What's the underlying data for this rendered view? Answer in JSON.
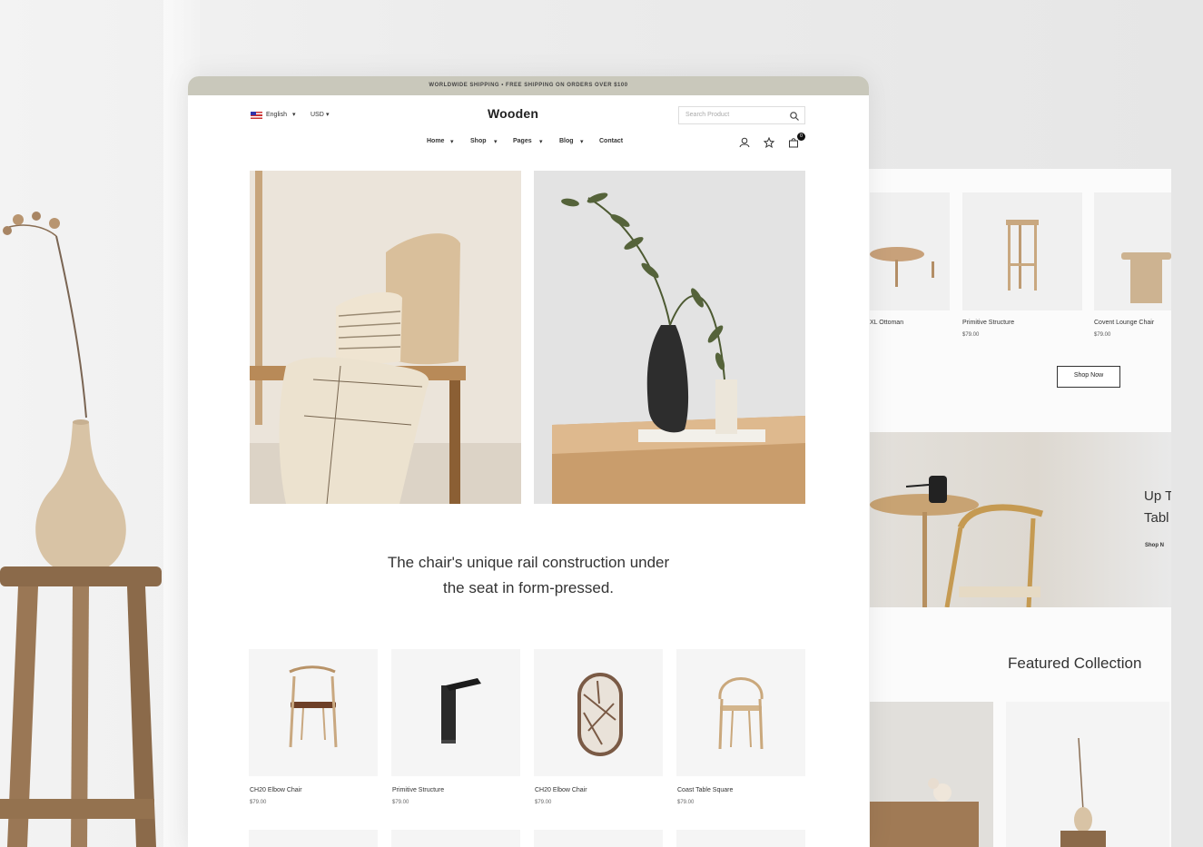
{
  "topbar": {
    "announcement": "WORLDWIDE SHIPPING • FREE SHIPPING ON ORDERS OVER $100"
  },
  "header": {
    "language": "English",
    "currency": "USD",
    "logo": "Wooden",
    "search_placeholder": "Search Product",
    "cart_count": "0"
  },
  "nav": [
    {
      "label": "Home"
    },
    {
      "label": "Shop"
    },
    {
      "label": "Pages"
    },
    {
      "label": "Blog"
    },
    {
      "label": "Contact"
    }
  ],
  "tagline": {
    "line1": "The chair's unique rail construction under",
    "line2": "the seat in form-pressed."
  },
  "products": [
    {
      "name": "CH20 Elbow Chair",
      "price": "$79.00"
    },
    {
      "name": "Primitive Structure",
      "price": "$79.00"
    },
    {
      "name": "CH20 Elbow Chair",
      "price": "$79.00"
    },
    {
      "name": "Coast Table Square",
      "price": "$79.00"
    }
  ],
  "back_page": {
    "products": [
      {
        "name": "XL Ottoman",
        "price": ""
      },
      {
        "name": "Primitive Structure",
        "price": "$79.00"
      },
      {
        "name": "Covent Lounge Chair",
        "price": "$79.00"
      }
    ],
    "shop_now": "Shop Now",
    "banner_title_1": "Up T",
    "banner_title_2": "Tabl",
    "banner_link": "Shop N",
    "featured": "Featured Collection"
  },
  "colors": {
    "topbar": "#c9c8bb",
    "wood": "#c9a074",
    "background": "#ebebeb"
  }
}
